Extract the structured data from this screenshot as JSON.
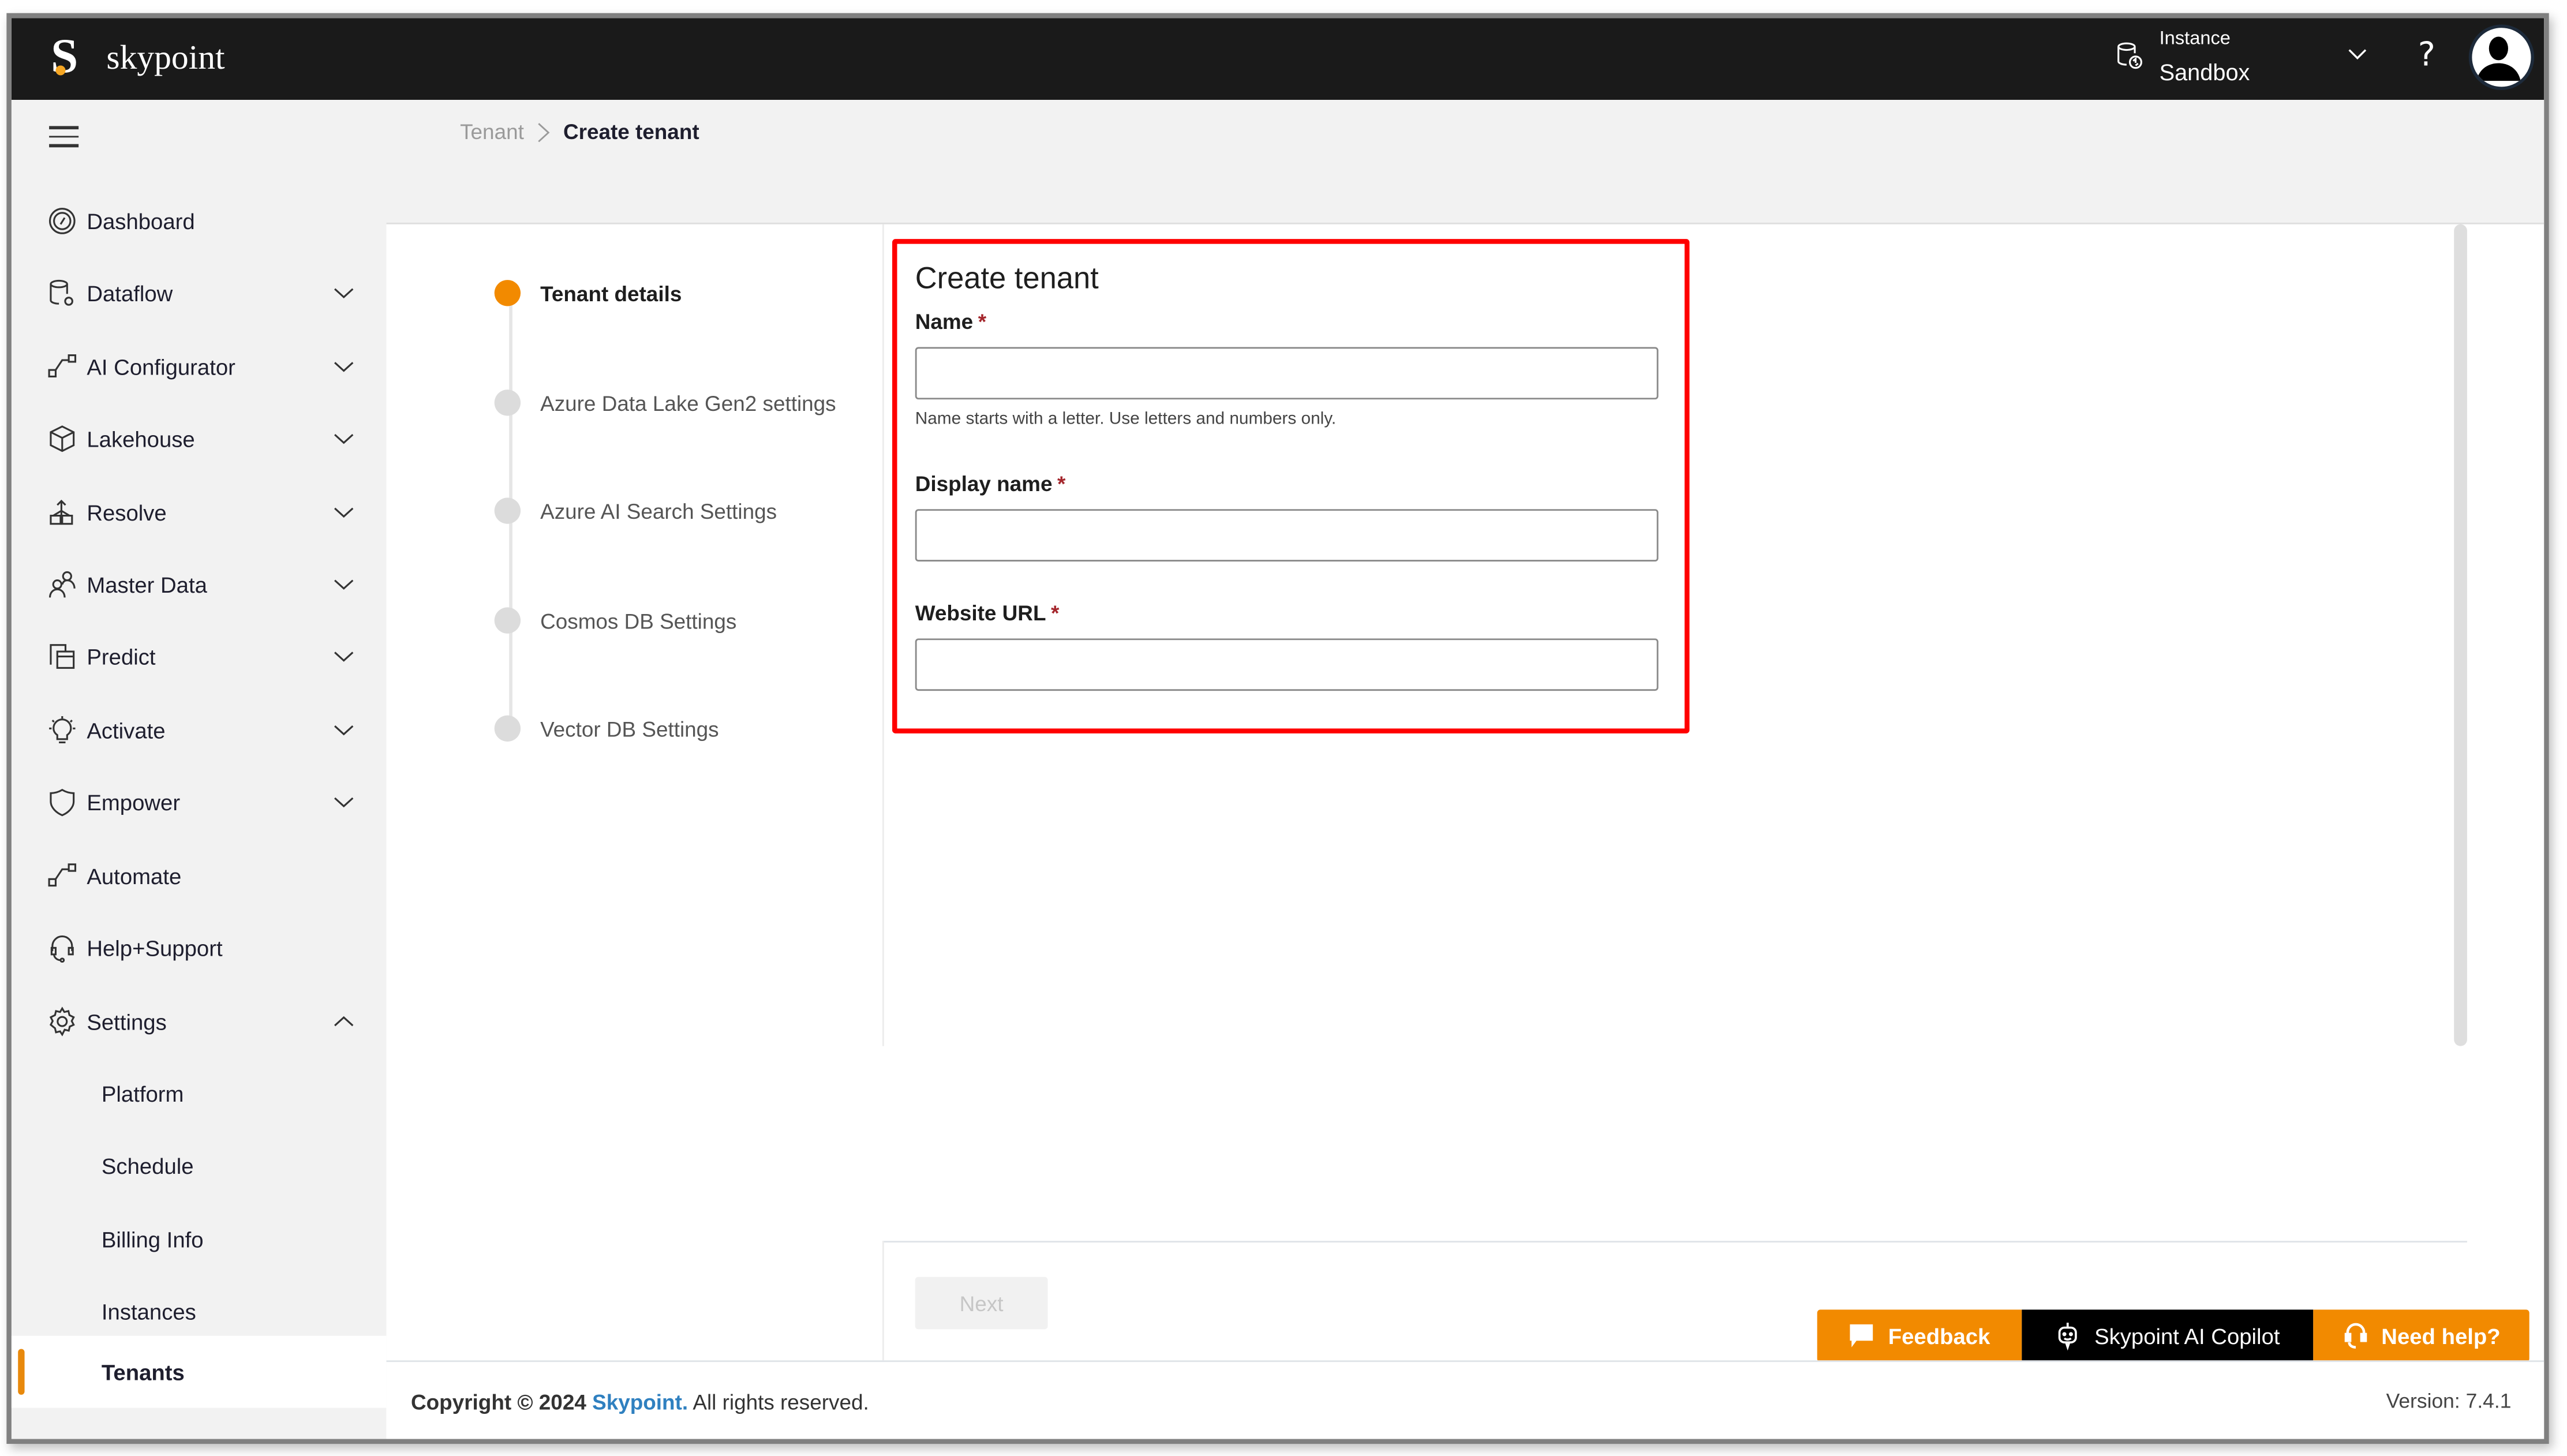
{
  "app": {
    "brand": "skypoint",
    "brand_accent": "#f5a623"
  },
  "header": {
    "instance_label": "Instance",
    "instance_value": "Sandbox",
    "help_glyph": "?"
  },
  "sidebar": {
    "items": [
      {
        "label": "Dashboard",
        "icon": "dashboard-gauge-icon",
        "expandable": false
      },
      {
        "label": "Dataflow",
        "icon": "database-gear-icon",
        "expandable": true
      },
      {
        "label": "AI Configurator",
        "icon": "flow-connector-icon",
        "expandable": true
      },
      {
        "label": "Lakehouse",
        "icon": "cube-icon",
        "expandable": true
      },
      {
        "label": "Resolve",
        "icon": "merge-boxes-icon",
        "expandable": true
      },
      {
        "label": "Master Data",
        "icon": "people-icon",
        "expandable": true
      },
      {
        "label": "Predict",
        "icon": "overlapping-squares-icon",
        "expandable": true
      },
      {
        "label": "Activate",
        "icon": "lightbulb-icon",
        "expandable": true
      },
      {
        "label": "Empower",
        "icon": "shield-icon",
        "expandable": true
      },
      {
        "label": "Automate",
        "icon": "flow-connector-icon",
        "expandable": false
      },
      {
        "label": "Help+Support",
        "icon": "headset-icon",
        "expandable": false
      },
      {
        "label": "Settings",
        "icon": "gear-icon",
        "expandable": true,
        "expanded": true
      }
    ],
    "settings_children": [
      {
        "label": "Platform",
        "active": false
      },
      {
        "label": "Schedule",
        "active": false
      },
      {
        "label": "Billing Info",
        "active": false
      },
      {
        "label": "Instances",
        "active": false
      },
      {
        "label": "Tenants",
        "active": true
      }
    ]
  },
  "breadcrumb": {
    "parent": "Tenant",
    "current": "Create tenant"
  },
  "stepper": {
    "steps": [
      {
        "label": "Tenant details",
        "active": true
      },
      {
        "label": "Azure Data Lake Gen2 settings",
        "active": false
      },
      {
        "label": "Azure AI Search Settings",
        "active": false
      },
      {
        "label": "Cosmos DB Settings",
        "active": false
      },
      {
        "label": "Vector DB Settings",
        "active": false
      }
    ]
  },
  "form": {
    "title": "Create tenant",
    "required_marker": "*",
    "fields": [
      {
        "label": "Name",
        "value": "",
        "placeholder": "",
        "hint": "Name starts with a letter. Use letters and numbers only."
      },
      {
        "label": "Display name",
        "value": "",
        "placeholder": ""
      },
      {
        "label": "Website URL",
        "value": "",
        "placeholder": ""
      }
    ],
    "next_label": "Next",
    "next_disabled": true
  },
  "floating_actions": {
    "feedback": "Feedback",
    "copilot": "Skypoint AI Copilot",
    "help": "Need help?",
    "accent": "#f28a00"
  },
  "footer": {
    "copyright_prefix": "Copyright © 2024",
    "brand_link": "Skypoint.",
    "copyright_suffix": "All rights reserved.",
    "version": "Version: 7.4.1"
  },
  "colors": {
    "topbar": "#1a1a1a",
    "sidebar_bg": "#f2f2f2",
    "active_indicator": "#e8890c",
    "highlight_box": "#ff0000",
    "link": "#2f80c0"
  }
}
